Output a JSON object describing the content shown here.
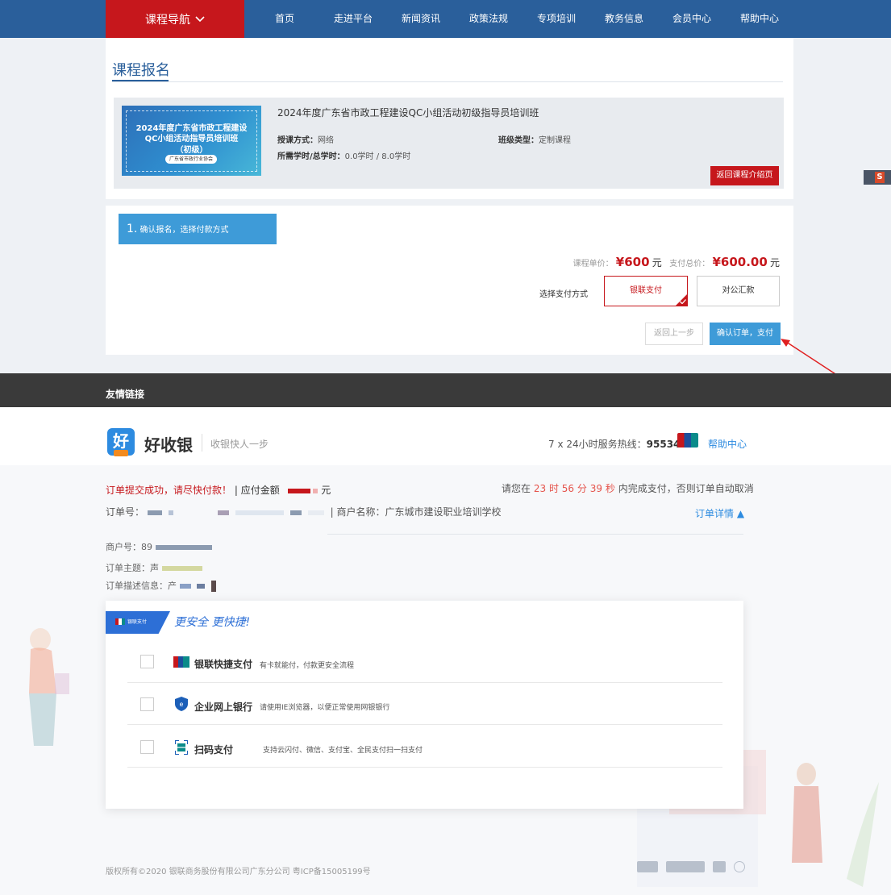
{
  "nav": {
    "course_nav": "课程导航",
    "items": [
      "首页",
      "走进平台",
      "新闻资讯",
      "政策法规",
      "专项培训",
      "教务信息",
      "会员中心",
      "帮助中心"
    ]
  },
  "registration": {
    "title": "课程报名",
    "course": {
      "thumb_line1": "2024年度广东省市政工程建设",
      "thumb_line2": "QC小组活动指导员培训班",
      "thumb_line3": "（初级）",
      "thumb_badge": "广东省市政行业协会",
      "name": "2024年度广东省市政工程建设QC小组活动初级指导员培训班",
      "mode_label": "授课方式：",
      "mode_value": "网络",
      "class_type_label": "班级类型：",
      "class_type_value": "定制课程",
      "hours_label": "所需学时/总学时：",
      "hours_value": "0.0学时 / 8.0学时",
      "back_button": "返回课程介绍页"
    },
    "side_tab": "S",
    "step": {
      "number": "1.",
      "label": "确认报名，选择付款方式"
    },
    "price": {
      "unit_label": "课程单价：",
      "unit_value": "¥600",
      "total_label": "支付总价：",
      "total_value": "¥600.00",
      "currency": "元"
    },
    "payment": {
      "label": "选择支付方式",
      "unionpay": "银联支付",
      "corporate": "对公汇款"
    },
    "prev_button": "返回上一步",
    "confirm_button": "确认订单，支付"
  },
  "footer": {
    "links_title": "友情链接"
  },
  "cashier": {
    "logo_char": "好",
    "brand": "好收银",
    "slogan": "收银快人一步",
    "hotline_prefix": "7 x 24小时服务热线：",
    "hotline_number": "95534",
    "help": "帮助中心",
    "order_success": "订单提交成功，请尽快付款！",
    "amount_label": "| 应付金额",
    "amount_unit": "元",
    "countdown_prefix": "请您在",
    "countdown_hours": "23",
    "countdown_h": "时",
    "countdown_minutes": "56",
    "countdown_m": "分",
    "countdown_seconds": "39",
    "countdown_s": "秒",
    "countdown_suffix": "内完成支付，否则订单自动取消",
    "order_no_label": "订单号：",
    "merchant_name": "| 商户名称：广东城市建设职业培训学校",
    "order_detail": "订单详情 ▲",
    "merchant_no": "商户号：89",
    "order_subject": "订单主题：声",
    "order_desc": "订单描述信息：产",
    "card_flag": "银联支付",
    "tagline": "更安全 更快捷!",
    "options": [
      {
        "title": "银联快捷支付",
        "desc": "有卡就能付，付款更安全流程",
        "icon": "unionpay-card-icon"
      },
      {
        "title": "企业网上银行",
        "desc": "请使用IE浏览器，以便正常使用网银银行",
        "icon": "bank-shield-icon"
      },
      {
        "title": "扫码支付",
        "desc": "支持云闪付、微信、支付宝、全民支付扫一扫支付",
        "icon": "qr-scan-icon"
      }
    ],
    "copyright": "版权所有©2020  银联商务股份有限公司广东分公司  粤ICP备15005199号"
  },
  "colors": {
    "nav_blue": "#2a5f9b",
    "brand_red": "#c6171c",
    "action_blue": "#3e9bd8",
    "cashier_blue": "#2d8be0"
  }
}
